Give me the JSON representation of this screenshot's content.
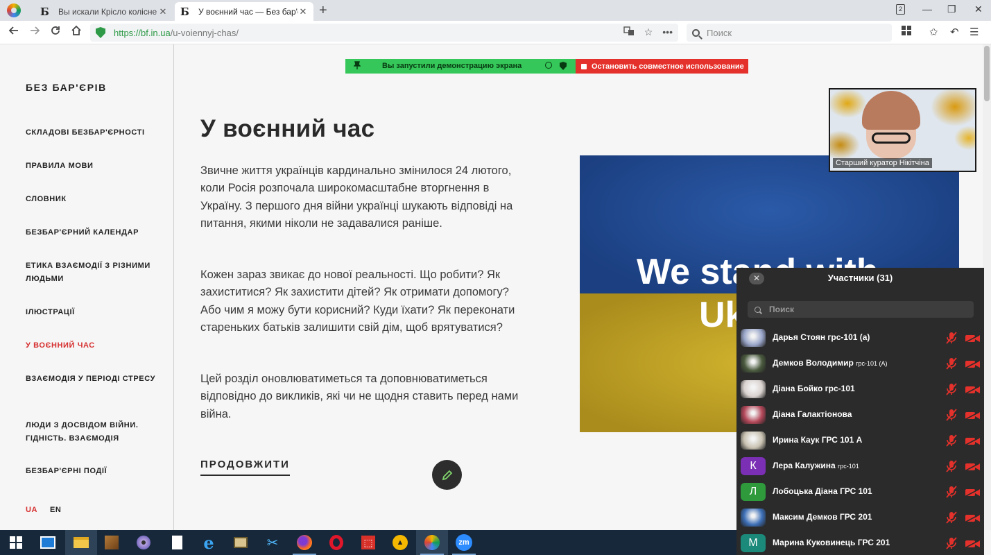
{
  "browser": {
    "tabs": [
      {
        "favicon": "Б",
        "title": "Вы искали Крісло колісне — ",
        "close": "✕"
      },
      {
        "favicon": "Б",
        "title": "У воєнний час — Без бар'єр",
        "close": "✕"
      }
    ],
    "new_tab": "+",
    "tab_count": "2",
    "window_controls": {
      "minimize": "—",
      "restore": "❐",
      "close": "✕"
    },
    "url": {
      "protocol": "https://",
      "host": "bf.in.ua",
      "path": "/u-voiennyj-chas/"
    },
    "search_placeholder": "Поиск"
  },
  "share_bar": {
    "message": "Вы запустили демонстрацию экрана",
    "stop_label": "Остановить совместное использование",
    "colors": {
      "green": "#35c759",
      "red": "#e5312b"
    }
  },
  "sidebar": {
    "brand": "БЕЗ БАР'ЄРІВ",
    "items": [
      {
        "label": "СКЛАДОВІ БЕЗБАР'ЄРНОСТІ"
      },
      {
        "label": "ПРАВИЛА МОВИ"
      },
      {
        "label": "СЛОВНИК"
      },
      {
        "label": "БЕЗБАР'ЄРНИЙ КАЛЕНДАР"
      },
      {
        "label": "ЕТИКА ВЗАЄМОДІЇ З РІЗНИМИ ЛЮДЬМИ"
      },
      {
        "label": "ІЛЮСТРАЦІЇ"
      },
      {
        "label": "У ВОЄННИЙ ЧАС",
        "active": true
      },
      {
        "label": "ВЗАЄМОДІЯ У ПЕРІОДІ СТРЕСУ"
      },
      {
        "label": "ЛЮДИ З ДОСВІДОМ ВІЙНИ. ГІДНІСТЬ. ВЗАЄМОДІЯ"
      },
      {
        "label": "БЕЗБАР'ЄРНІ ПОДІЇ"
      }
    ],
    "languages": {
      "ua": "UA",
      "en": "EN"
    },
    "accent_color": "#d62e2e"
  },
  "main": {
    "title": "У воєнний час",
    "paragraphs": [
      "Звичне життя українців кардинально змінилося 24 лютого, коли Росія розпочала широкомасштабне вторгнення в Україну. З першого дня війни українці шукають відповіді на питання, якими ніколи не задавалися раніше.",
      "Кожен зараз звикає до нової реальності. Що робити? Як захиститися? Як захистити дітей? Як отримати допомогу? Або чим я можу бути корисний? Куди їхати? Як переконати стареньких батьків залишити свій дім, щоб врятуватися?",
      "Цей розділ оновлюватиметься та доповнюватиметься відповідно до викликів, які чи не щодня ставить перед нами війна."
    ],
    "cta": "ПРОДОВЖИТИ",
    "banner": {
      "line1": "We stand with",
      "line2": "Ukraine"
    }
  },
  "video": {
    "name": "Старший куратор Нікітчіна"
  },
  "participants": {
    "title": "Участники (31)",
    "search_placeholder": "Поиск",
    "list": [
      {
        "name": "Дарья Стоян грс-101 (а)",
        "avatar": "photo",
        "color": "#9aa6c9"
      },
      {
        "name": "Демков Володимир",
        "suffix": "грс-101 (А)",
        "avatar": "photo",
        "color": "#4a5a3e"
      },
      {
        "name": "Діана Бойко грс-101",
        "avatar": "photo",
        "color": "#d9d2cf"
      },
      {
        "name": "Діана Галактіонова",
        "avatar": "photo",
        "color": "#b4485a"
      },
      {
        "name": "Ирина Каук ГРС 101 А",
        "avatar": "photo",
        "color": "#c9c2b2"
      },
      {
        "name": "Лера Калужина",
        "suffix": "грс-101",
        "avatar": "К",
        "color": "#7b2fb5"
      },
      {
        "name": "Лобоцька Діана ГРС 101",
        "avatar": "Л",
        "color": "#2e9a3c"
      },
      {
        "name": "Максим Демков ГРС 201",
        "avatar": "photo",
        "color": "#3d6fb6"
      },
      {
        "name": "Марина Куковинець ГРС 201",
        "avatar": "М",
        "color": "#1c8a7a"
      }
    ],
    "icon_color": "#e5312b"
  },
  "taskbar": {
    "items": [
      "windows-start-icon",
      "store-icon",
      "file-explorer-icon",
      "winrar-icon",
      "media-disc-icon",
      "document-icon",
      "edge-icon",
      "photo-viewer-icon",
      "snipping-tool-icon",
      "firefox-icon",
      "opera-icon",
      "pdf-icon",
      "app-triangle-icon",
      "browser-icon",
      "zoom-icon"
    ],
    "zoom_label": "zm"
  }
}
